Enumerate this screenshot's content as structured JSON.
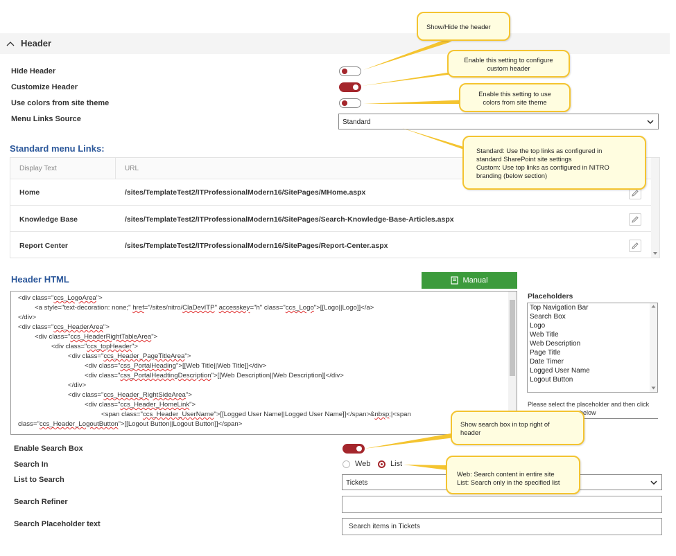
{
  "section": {
    "title": "Header"
  },
  "settings": {
    "hide_header": "Hide Header",
    "customize_header": "Customize Header",
    "use_colors": "Use colors from site theme",
    "menu_links_source": "Menu Links Source",
    "menu_links_value": "Standard"
  },
  "menu_links": {
    "heading": "Standard menu Links:",
    "columns": [
      "Display Text",
      "URL"
    ],
    "rows": [
      {
        "text": "Home",
        "url": "/sites/TemplateTest2/ITProfessionalModern16/SitePages/MHome.aspx"
      },
      {
        "text": "Knowledge Base",
        "url": "/sites/TemplateTest2/ITProfessionalModern16/SitePages/Search-Knowledge-Base-Articles.aspx"
      },
      {
        "text": "Report Center",
        "url": "/sites/TemplateTest2/ITProfessionalModern16/SitePages/Report-Center.aspx"
      }
    ]
  },
  "header_html": {
    "heading": "Header HTML",
    "manual_button": "Manual"
  },
  "placeholders": {
    "title": "Placeholders",
    "items": [
      "Top Navigation Bar",
      "Search Box",
      "Logo",
      "Web Title",
      "Web Description",
      "Page Title",
      "Date Timer",
      "Logged User Name",
      "Logout Button"
    ],
    "note_line1": "Please select the placeholder and then click",
    "note_line2": "below"
  },
  "search": {
    "enable_label": "Enable Search Box",
    "search_in_label": "Search In",
    "option_web": "Web",
    "option_list": "List",
    "list_to_search_label": "List to Search",
    "list_value": "Tickets",
    "refiner_label": "Search Refiner",
    "refiner_value": "",
    "placeholder_label": "Search Placeholder text",
    "placeholder_value": "Search items in Tickets"
  },
  "callouts": {
    "show_hide": "Show/Hide the header",
    "customize_l1": "Enable this setting to configure",
    "customize_l2": "custom header",
    "colors_l1": "Enable this setting to use",
    "colors_l2": "colors from site theme",
    "source_l1": "Standard: Use the top links as configured in",
    "source_l2": "standard SharePoint site settings",
    "source_l3": "Custom: Use top links as configured in NITRO",
    "source_l4": "branding (below section)",
    "search_box_l1": "Show search box in top right of",
    "search_box_l2": "header",
    "search_in_l1": "Web: Search content in entire site",
    "search_in_l2": "List: Search only in the specified list"
  },
  "colors": {
    "accent": "#a4262c",
    "heading": "#2b579a",
    "button": "#3c9b3c",
    "callout_border": "#f4c430",
    "callout_fill": "#fffde0"
  }
}
